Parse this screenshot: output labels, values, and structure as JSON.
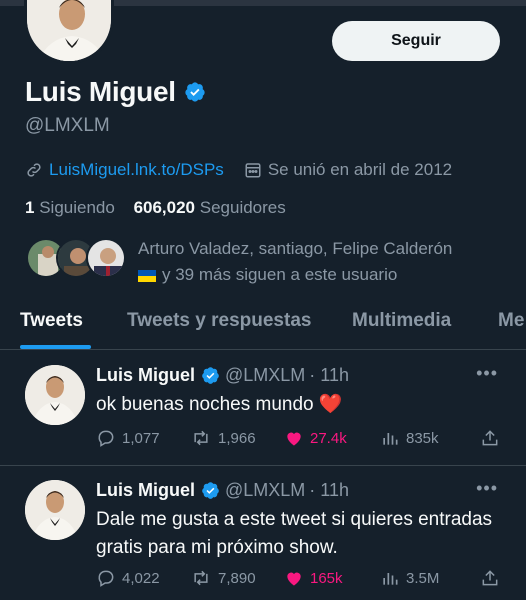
{
  "profile": {
    "name": "Luis Miguel",
    "handle": "@LMXLM",
    "follow_label": "Seguir",
    "website": "LuisMiguel.lnk.to/DSPs",
    "joined": "Se unió en abril de 2012",
    "following_count": "1",
    "following_label": "Siguiendo",
    "followers_count": "606,020",
    "followers_label": "Seguidores",
    "known_followers_line1": "Arturo Valadez, santiago, Felipe Calderón",
    "known_followers_line2": "y 39 más siguen a este usuario"
  },
  "tabs": [
    {
      "label": "Tweets"
    },
    {
      "label": "Tweets y respuestas"
    },
    {
      "label": "Multimedia"
    },
    {
      "label": "Me"
    }
  ],
  "tweets": [
    {
      "name": "Luis Miguel",
      "handle": "@LMXLM",
      "time": "· 11h",
      "text": "ok buenas noches mundo ❤️",
      "replies": "1,077",
      "retweets": "1,966",
      "likes": "27.4k",
      "views": "835k"
    },
    {
      "name": "Luis Miguel",
      "handle": "@LMXLM",
      "time": "· 11h",
      "text": "Dale me gusta a este tweet si quieres entradas gratis para mi próximo show.",
      "replies": "4,022",
      "retweets": "7,890",
      "likes": "165k",
      "views": "3.5M"
    }
  ],
  "colors": {
    "background": "#15202b",
    "accent": "#1d9bf0",
    "like": "#f91880",
    "muted": "#8b98a5"
  }
}
